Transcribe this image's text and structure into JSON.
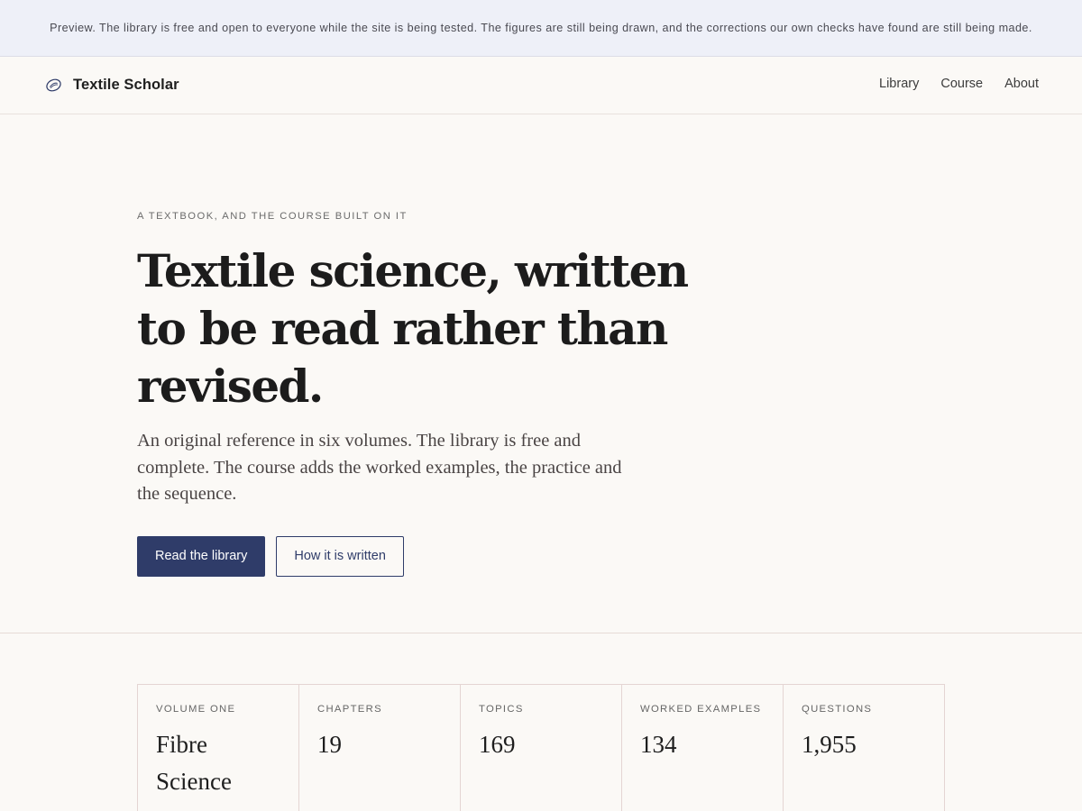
{
  "banner": {
    "text": "Preview. The library is free and open to everyone while the site is being tested. The figures are still being drawn, and the corrections our own checks have found are still being made."
  },
  "nav": {
    "brand": "Textile Scholar",
    "brand_icon": "thread-spool-icon",
    "links": [
      "Library",
      "Course",
      "About"
    ]
  },
  "hero": {
    "eyebrow": "A textbook, and the course built on it",
    "title": "Textile science, written to be read rather than revised.",
    "lede": "An original reference in six volumes. The library is free and complete. The course adds the worked examples, the practice and the sequence.",
    "primary_cta": "Read the library",
    "secondary_cta": "How it is written"
  },
  "stats": [
    {
      "label": "Volume one",
      "value": "Fibre Science"
    },
    {
      "label": "Chapters",
      "value": "19"
    },
    {
      "label": "Topics",
      "value": "169"
    },
    {
      "label": "Worked examples",
      "value": "134"
    },
    {
      "label": "Questions",
      "value": "1,955"
    }
  ],
  "colors": {
    "accent": "#2f3c69",
    "background": "#fbf9f6",
    "banner": "#eef0f8"
  }
}
